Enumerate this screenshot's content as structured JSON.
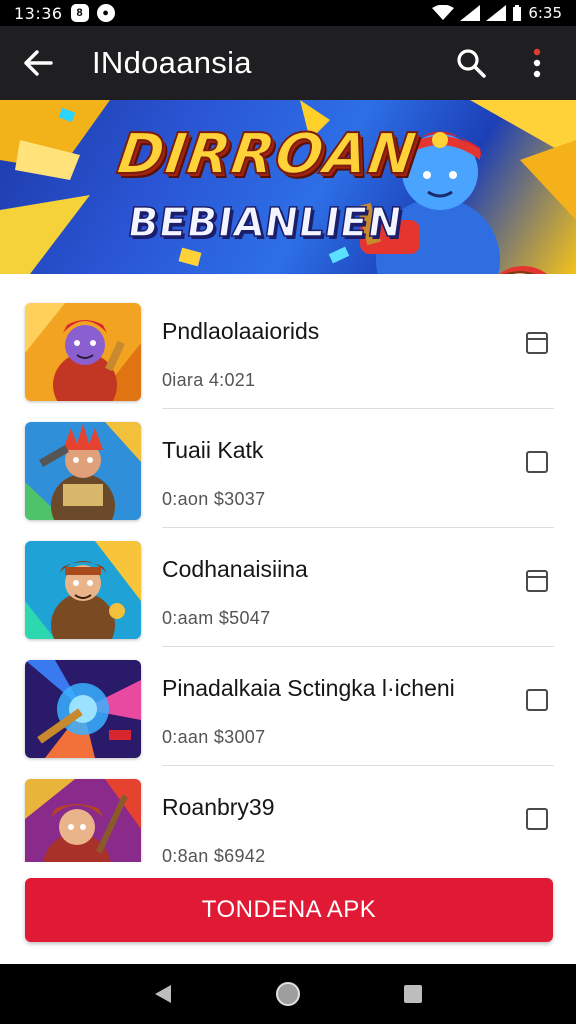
{
  "status_bar": {
    "time_left": "13:36",
    "time_right": "6:35",
    "left_icons": [
      "notification-icon",
      "app-icon"
    ],
    "right_icons": [
      "wifi-icon",
      "signal-icon",
      "battery-icon"
    ]
  },
  "app_bar": {
    "title": "INdoaansia",
    "back_icon": "arrow-left-icon",
    "search_icon": "search-icon",
    "menu_icon": "more-vertical-icon",
    "menu_badge_color": "#e53935"
  },
  "banner": {
    "title": "DIRROAN",
    "subtitle": "BEBIANLIEN"
  },
  "list": {
    "items": [
      {
        "title": "Pndlaolaaiorids",
        "meta": "0iara  4:021",
        "checkbox": "indeterminate"
      },
      {
        "title": "Tuaii Katk",
        "meta": "0:aon  $3037",
        "checkbox": "unchecked"
      },
      {
        "title": "Codhanaisiina",
        "meta": "0:aam  $5047",
        "checkbox": "indeterminate"
      },
      {
        "title": "Pinadalkaia Sctingka l·icheni",
        "meta": "0:aan  $3007",
        "checkbox": "unchecked"
      },
      {
        "title": "Roanbry39",
        "meta": "0:8an  $6942",
        "checkbox": "unchecked"
      }
    ]
  },
  "cta": {
    "label": "TONDENA APK",
    "color": "#e01935"
  },
  "nav_bar": {
    "icons": [
      "nav-back-icon",
      "nav-home-icon",
      "nav-recents-icon"
    ]
  }
}
